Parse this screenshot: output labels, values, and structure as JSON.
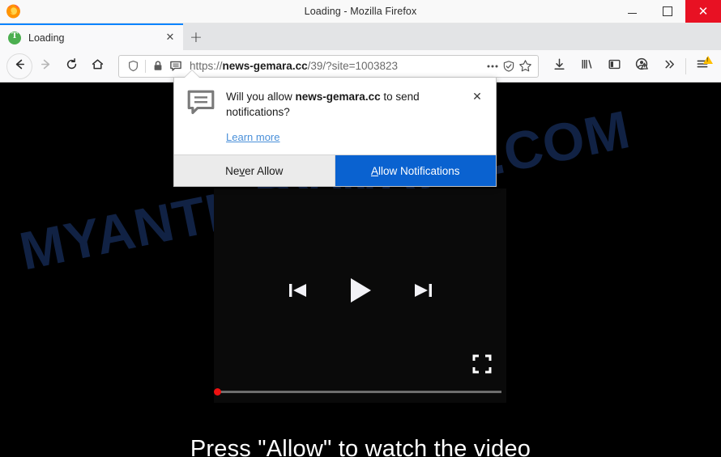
{
  "window": {
    "title": "Loading - Mozilla Firefox",
    "logo_icon": "firefox-logo-icon",
    "controls": {
      "minimize_label": "—",
      "maximize_label": "□",
      "close_label": "✕"
    }
  },
  "tabs": {
    "items": [
      {
        "label": "Loading",
        "favicon": "green-loading-favicon",
        "close_label": "✕"
      }
    ],
    "new_tab_label": "+"
  },
  "toolbar": {
    "back_icon": "back-arrow-icon",
    "forward_icon": "forward-arrow-icon",
    "reload_icon": "reload-icon",
    "home_icon": "home-icon",
    "download_icon": "download-icon",
    "library_icon": "library-icon",
    "sidebar_icon": "sidebar-icon",
    "account_icon": "account-warning-icon",
    "overflow_icon": "chevron-double-right-icon",
    "menu_icon": "hamburger-menu-icon",
    "menu_badge": "!"
  },
  "urlbar": {
    "shield_icon": "tracking-protection-shield-icon",
    "lock_icon": "padlock-icon",
    "permission_icon": "notification-permission-icon",
    "scheme": "https://",
    "host": "news-gemara.cc",
    "path": "/39/?site=1003823",
    "full_url": "https://news-gemara.cc/39/?site=1003823",
    "page_actions_icon": "ellipsis-icon",
    "reader_icon": "reader-mode-icon",
    "bookmark_icon": "star-bookmark-icon"
  },
  "doorhanger": {
    "icon": "speech-bubble-notification-icon",
    "question_prefix": "Will you allow ",
    "question_host": "news-gemara.cc",
    "question_suffix": " to send notifications?",
    "learn_more": "Learn more",
    "close_label": "✕",
    "never_allow": {
      "prefix": "Ne",
      "accel": "v",
      "suffix": "er Allow"
    },
    "allow": {
      "accel": "A",
      "suffix": "llow Notifications"
    },
    "primary_color": "#0a62d0"
  },
  "page": {
    "background_color": "#000000",
    "watermark": "MYANTISPYWARE.COM",
    "watermark_color": "#13254a",
    "cta_text": "Press \"Allow\" to watch the video",
    "player": {
      "prev_icon": "skip-previous-icon",
      "play_icon": "play-icon",
      "next_icon": "skip-next-icon",
      "fullscreen_icon": "fullscreen-icon",
      "progress_percent": 0,
      "progress_dot_color": "#ee1111"
    }
  }
}
